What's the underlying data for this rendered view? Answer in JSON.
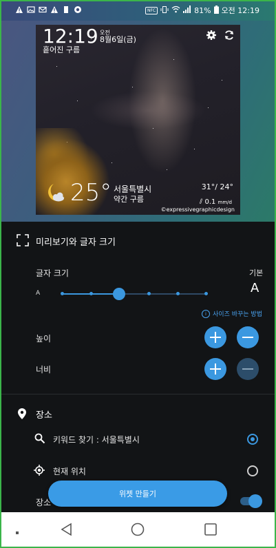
{
  "status_bar": {
    "battery": "81%",
    "time": "오전 12:19",
    "icons": [
      "warning-icon",
      "image-icon",
      "gmail-icon",
      "warning-icon",
      "sd-icon",
      "chrome-icon",
      "nfc-icon",
      "vibrate-icon",
      "wifi-icon",
      "signal-icon",
      "battery-icon"
    ]
  },
  "preview": {
    "clock": "12:19",
    "ampm": "오전",
    "date": "8월6일(금)",
    "condition": "흩어진 구름",
    "temperature": "25°",
    "city": "서울특별시",
    "weather_desc": "약간 구름",
    "hi_lo": "31°/ 24°",
    "rain_value": "0.1",
    "rain_unit": "mm/d",
    "credit": "©expressivegraphicdesign"
  },
  "preview_section": {
    "title": "미리보기와 글자 크기",
    "font_size_label": "글자 크기",
    "default_label": "기본",
    "small_a": "A",
    "large_a": "A",
    "slider_steps": 7,
    "slider_value_step": 3,
    "how_to_link": "사이즈 바꾸는 방법",
    "height_label": "높이",
    "width_label": "너비"
  },
  "location_section": {
    "title": "장소",
    "keyword_search": "키워드 찾기 : 서울특별시",
    "current_location": "현재 위치",
    "keyword_selected": true,
    "partial_label": "장소",
    "toggle_on": true
  },
  "make_button": "위젯 만들기",
  "colors": {
    "accent": "#3b98e0",
    "panel_bg": "#121416"
  }
}
